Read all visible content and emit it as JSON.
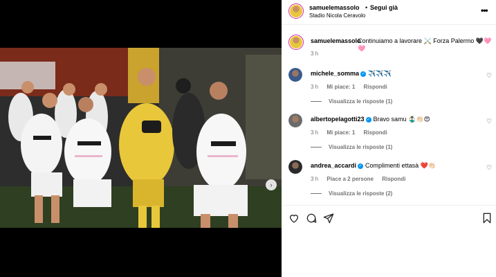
{
  "post": {
    "username": "samuelemassolo",
    "separator": "•",
    "follow_label": "Segui già",
    "location": "Stadio Nicola Ceravolo",
    "more_label": "•••",
    "caption_text": "Continuiamo a lavorare ⚔️ Forza Palermo 🖤🩷🩷",
    "caption_time": "3 h"
  },
  "media": {
    "next_label": "›"
  },
  "comments": [
    {
      "user": "michele_somma",
      "verified": true,
      "text": "✈️✈️✈️",
      "time": "3 h",
      "likes": "Mi piace: 1",
      "reply": "Rispondi",
      "replies": "Visualizza le risposte (1)"
    },
    {
      "user": "albertopelagotti23",
      "verified": true,
      "text": "Bravo samu 🤹🏼‍♂️👏🏻😍",
      "time": "3 h",
      "likes": "Mi piace: 1",
      "reply": "Rispondi",
      "replies": "Visualizza le risposte (1)"
    },
    {
      "user": "andrea_accardi",
      "verified": true,
      "text": "Complimenti ettasà ❤️👏🏻",
      "time": "3 h",
      "likes": "Piace a 2 persone",
      "reply": "Rispondi",
      "replies": "Visualizza le risposte (2)"
    }
  ],
  "icons": {
    "heart": "heart-icon",
    "comment": "comment-icon",
    "share": "share-icon",
    "save": "bookmark-icon",
    "more": "more-icon",
    "tag": "user-tag-icon",
    "verified": "verified-badge-icon"
  },
  "colors": {
    "accent": "#0095f6",
    "story_ring": "#d6249f",
    "muted": "#737373",
    "jersey_yellow": "#e8c73a",
    "jersey_white": "#f2f2f2"
  }
}
